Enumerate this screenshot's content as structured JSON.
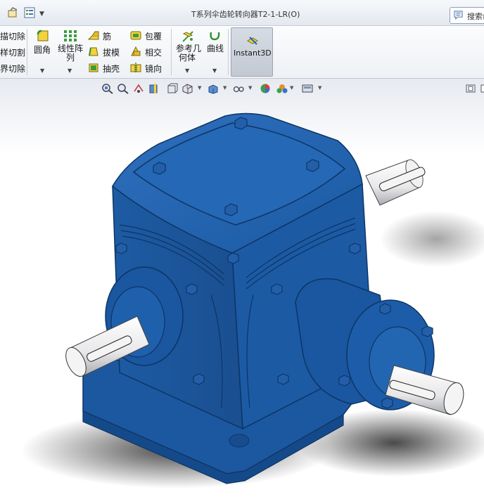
{
  "window": {
    "title": "T系列伞齿轮转向器T2-1-LR(O)"
  },
  "search": {
    "label": "搜索命"
  },
  "ribbon": {
    "left_items": [
      "描切除",
      "样切割",
      "界切除"
    ],
    "fillet": "圆角",
    "linear_pattern_line1": "线性阵",
    "linear_pattern_line2": "列",
    "rib": "筋",
    "draft": "拔模",
    "shell": "抽壳",
    "wrap": "包覆",
    "intersect": "相交",
    "mirror": "镜向",
    "ref_geometry_line1": "参考几",
    "ref_geometry_line2": "何体",
    "curves": "曲线",
    "instant3d": "Instant3D"
  },
  "colors": {
    "model_blue": "#1f5fa8",
    "model_dark": "#0d3566",
    "shaft": "#e9e9ea",
    "background": "#ffffff"
  }
}
